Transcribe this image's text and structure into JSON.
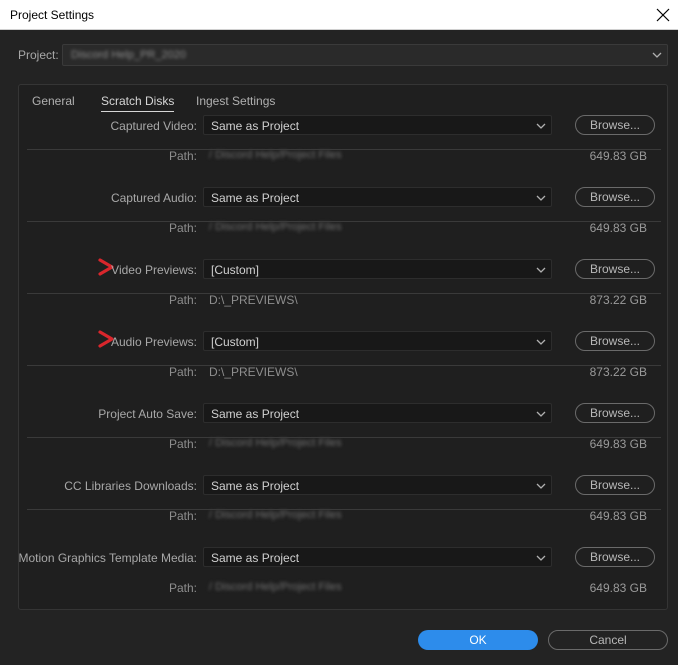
{
  "window": {
    "title": "Project Settings"
  },
  "project": {
    "label": "Project:",
    "value": "Discord Help_PR_2020"
  },
  "tabs": [
    {
      "label": "General",
      "active": false
    },
    {
      "label": "Scratch Disks",
      "active": true
    },
    {
      "label": "Ingest Settings",
      "active": false
    }
  ],
  "path_label": "Path:",
  "browse_label": "Browse...",
  "sections": [
    {
      "label": "Captured Video:",
      "value": "Same as Project",
      "path": "/ Discord Help/Project Files",
      "size": "649.83 GB",
      "path_blurred": true,
      "marked": false
    },
    {
      "label": "Captured Audio:",
      "value": "Same as Project",
      "path": "/ Discord Help/Project Files",
      "size": "649.83 GB",
      "path_blurred": true,
      "marked": false
    },
    {
      "label": "Video Previews:",
      "value": "[Custom]",
      "path": "D:\\_PREVIEWS\\",
      "size": "873.22 GB",
      "path_blurred": false,
      "marked": true
    },
    {
      "label": "Audio Previews:",
      "value": "[Custom]",
      "path": "D:\\_PREVIEWS\\",
      "size": "873.22 GB",
      "path_blurred": false,
      "marked": true
    },
    {
      "label": "Project Auto Save:",
      "value": "Same as Project",
      "path": "/ Discord Help/Project Files",
      "size": "649.83 GB",
      "path_blurred": true,
      "marked": false
    },
    {
      "label": "CC Libraries Downloads:",
      "value": "Same as Project",
      "path": "/ Discord Help/Project Files",
      "size": "649.83 GB",
      "path_blurred": true,
      "marked": false
    },
    {
      "label": "Motion Graphics Template Media:",
      "value": "Same as Project",
      "path": "/ Discord Help/Project Files",
      "size": "649.83 GB",
      "path_blurred": true,
      "marked": false
    }
  ],
  "buttons": {
    "ok": "OK",
    "cancel": "Cancel"
  },
  "colors": {
    "background": "#232323",
    "panel": "#1f1f1f",
    "accent": "#2d8ceb",
    "marker": "#d9262c"
  },
  "icons": {
    "close": "close-icon",
    "dropdown": "chevron-down-icon",
    "marker": "red-arrow-marker-icon"
  }
}
